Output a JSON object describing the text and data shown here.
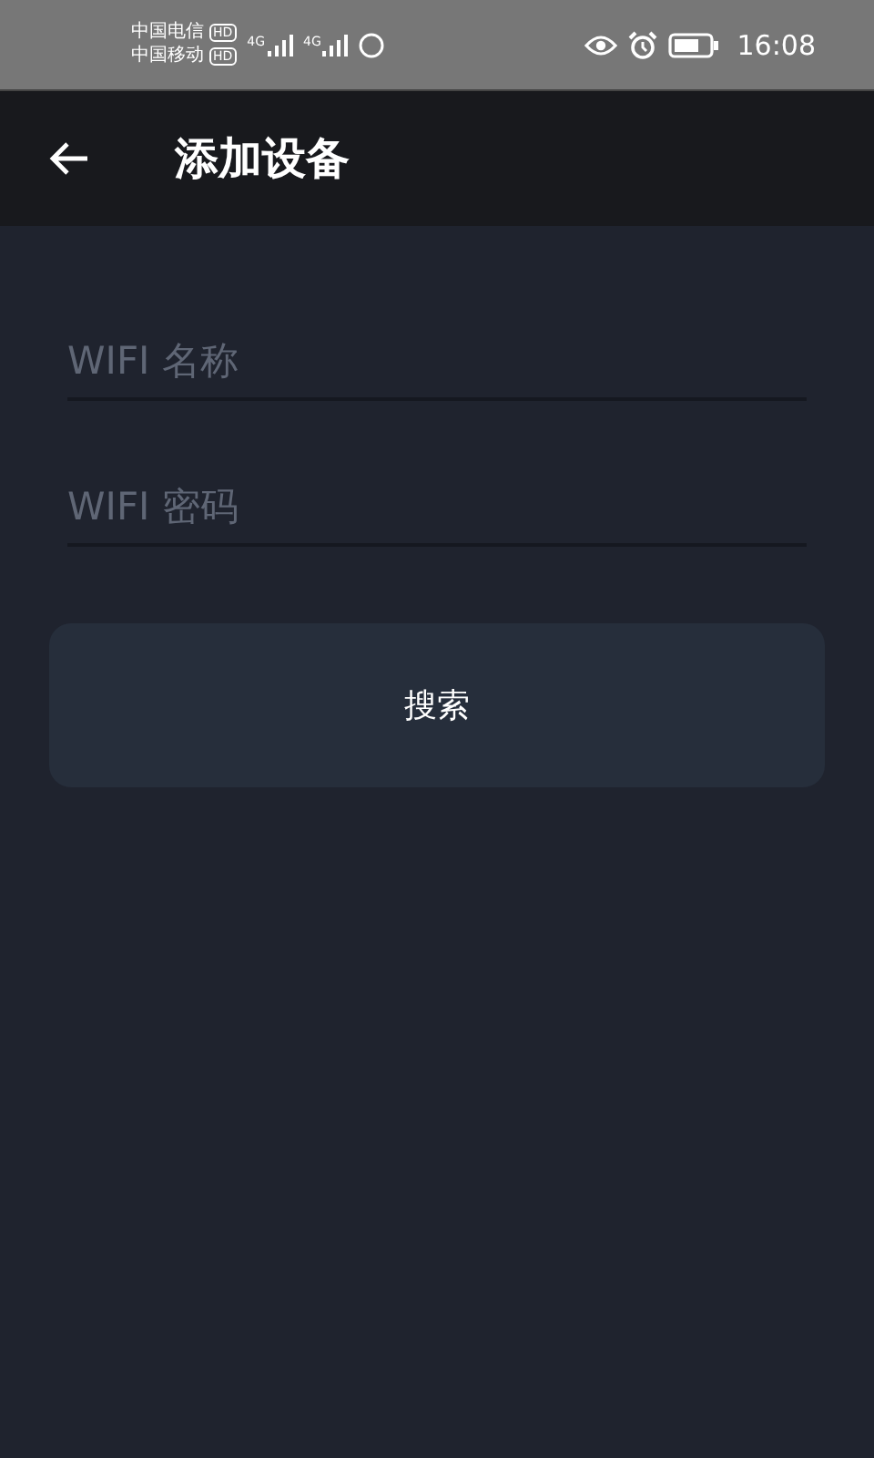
{
  "status_bar": {
    "carriers": [
      {
        "name": "中国电信",
        "badge": "HD",
        "network": "4G"
      },
      {
        "name": "中国移动",
        "badge": "HD",
        "network": "4G"
      }
    ],
    "time": "16:08"
  },
  "app_bar": {
    "title": "添加设备"
  },
  "fields": [
    {
      "placeholder": "WIFI 名称"
    },
    {
      "placeholder": "WIFI 密码"
    }
  ],
  "search_button": {
    "label": "搜索"
  }
}
